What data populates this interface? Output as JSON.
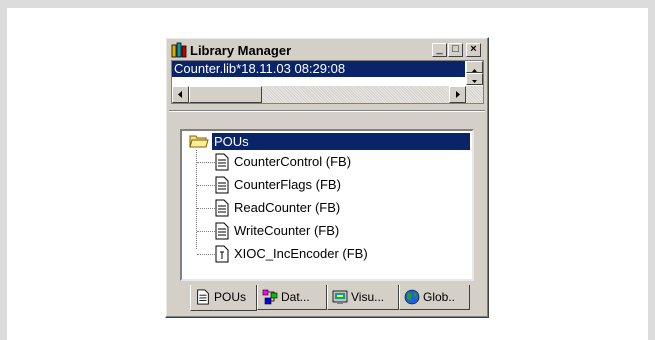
{
  "window": {
    "title": "Library Manager",
    "minimize_label": "_",
    "maximize_label": "□",
    "close_label": "×"
  },
  "library_list": {
    "selected": "Counter.lib*18.11.03 08:29:08"
  },
  "tree": {
    "root": "POUs",
    "items": [
      "CounterControl (FB)",
      "CounterFlags (FB)",
      "ReadCounter (FB)",
      "WriteCounter (FB)",
      "XIOC_IncEncoder (FB)"
    ]
  },
  "tabs": [
    {
      "label": "POUs",
      "icon": "document-icon"
    },
    {
      "label": "Dat...",
      "icon": "data-types-icon"
    },
    {
      "label": "Visu...",
      "icon": "visualization-icon"
    },
    {
      "label": "Glob..",
      "icon": "globe-icon"
    }
  ],
  "colors": {
    "selection": "#0a246a",
    "face": "#d4d0c8"
  }
}
